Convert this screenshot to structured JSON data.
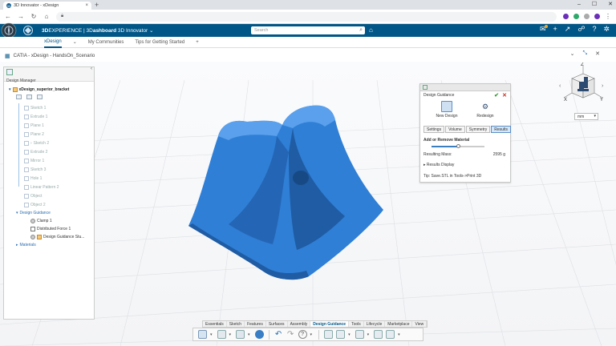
{
  "browser": {
    "tab_title": "3D Innovator - xDesign",
    "tab_close": "×",
    "new_tab": "+",
    "min": "–",
    "max": "☐",
    "close": "✕",
    "url_text": ""
  },
  "appbar": {
    "brand_3d": "3D",
    "brand_experience": "EXPERIENCE | 3D",
    "brand_dashboard": "ashboard",
    "brand_app": "3D Innovator",
    "search_placeholder": "Search"
  },
  "dashboard_tabs": [
    {
      "label": "xDesign"
    },
    {
      "label": "My Communities"
    },
    {
      "label": "Tips for Getting Started"
    },
    {
      "label": "+"
    }
  ],
  "docbar": {
    "title": "CATIA - xDesign - HandsOn_Scenario"
  },
  "tree": {
    "panel_label": "Design Manager",
    "root": "xDesign_superior_bracket",
    "items": [
      {
        "label": "Sketch 1",
        "style": "dim"
      },
      {
        "label": "Extrude 1",
        "style": "dim"
      },
      {
        "label": "Plane 1",
        "style": "dim"
      },
      {
        "label": "Plane 2",
        "style": "dim"
      },
      {
        "label": "Sketch 2",
        "style": "dim"
      },
      {
        "label": "Extrude 2",
        "style": "dim"
      },
      {
        "label": "Mirror 1",
        "style": "dim"
      },
      {
        "label": "Sketch 3",
        "style": "dim"
      },
      {
        "label": "Hole 1",
        "style": "dim"
      },
      {
        "label": "Linear Pattern 2",
        "style": "dim"
      },
      {
        "label": "Object",
        "style": "dim"
      },
      {
        "label": "Object 2",
        "style": "dim"
      }
    ],
    "guidance_node": "Design Guidance",
    "guidance_children": [
      {
        "label": "Clamp 1"
      },
      {
        "label": "Distributed Force 1"
      },
      {
        "label": "Design Guidance Stu..."
      }
    ],
    "materials_node": "Materials"
  },
  "design_guidance": {
    "title": "Design Guidance",
    "modes": [
      {
        "label": "New Design",
        "active": true
      },
      {
        "label": "Redesign",
        "active": false
      }
    ],
    "tabs": [
      {
        "label": "Settings",
        "active": false
      },
      {
        "label": "Volume",
        "active": false
      },
      {
        "label": "Symmetry",
        "active": false
      },
      {
        "label": "Results",
        "active": true
      }
    ],
    "section_label": "Add or Remove Material",
    "slider_fraction": 0.5,
    "mass_label": "Resulting Mass:",
    "mass_value": "2595 g",
    "results_display": "Results Display",
    "tip": "Tip: Save.STL in Tools->Print 3D"
  },
  "viewcube": {
    "z": "Z",
    "x": "X",
    "y": "Y"
  },
  "unit": {
    "value": "mm"
  },
  "actionbar": {
    "tabs": [
      {
        "label": "Essentials",
        "active": false
      },
      {
        "label": "Sketch",
        "active": false
      },
      {
        "label": "Features",
        "active": false
      },
      {
        "label": "Surfaces",
        "active": false
      },
      {
        "label": "Assembly",
        "active": false
      },
      {
        "label": "Design Guidance",
        "active": true
      },
      {
        "label": "Tools",
        "active": false
      },
      {
        "label": "Lifecycle",
        "active": false
      },
      {
        "label": "Marketplace",
        "active": false
      },
      {
        "label": "View",
        "active": false
      }
    ]
  },
  "colors": {
    "brand_blue": "#005686",
    "model_blue": "#2f7fd6",
    "accent_green": "#3a9b3a",
    "accent_red": "#c0392b"
  }
}
